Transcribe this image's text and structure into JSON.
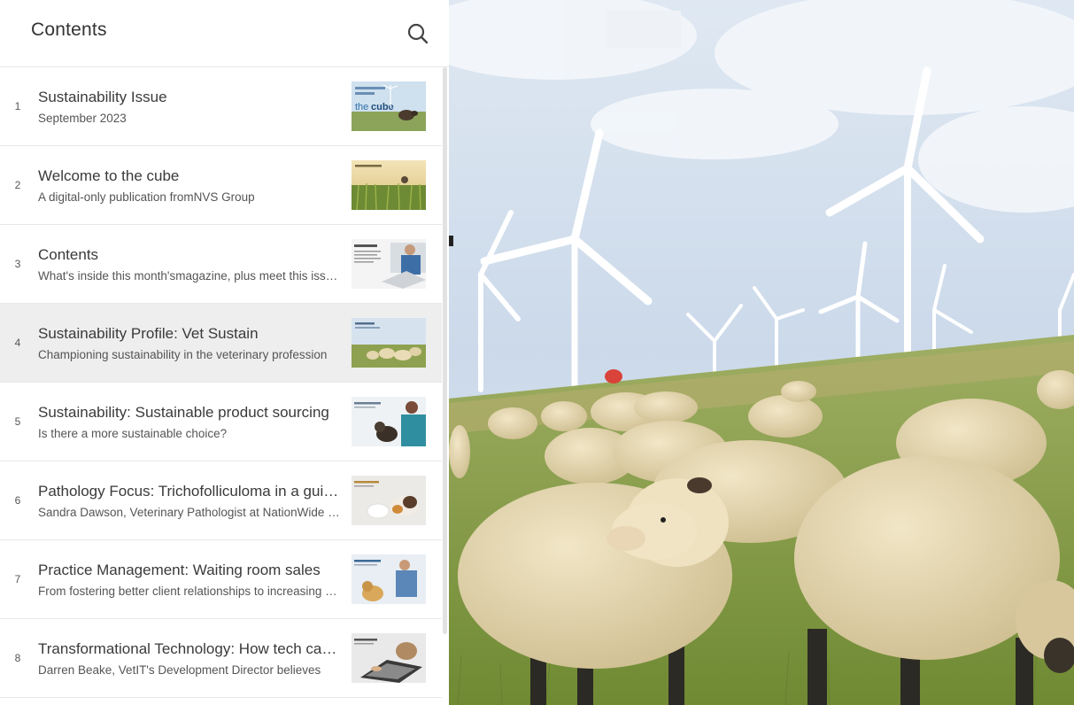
{
  "sidebar": {
    "title": "Contents",
    "search_icon": "search-icon",
    "items": [
      {
        "num": "1",
        "title": "Sustainability Issue",
        "subtitle": "September 2023",
        "thumb": "cube-cover"
      },
      {
        "num": "2",
        "title": "Welcome to the cube",
        "subtitle": "A digital-only publication fromNVS Group",
        "thumb": "field"
      },
      {
        "num": "3",
        "title": "Contents",
        "subtitle": "What's inside this month'smagazine, plus meet this issue's contributors",
        "thumb": "laptop"
      },
      {
        "num": "4",
        "title": "Sustainability Profile: Vet Sustain",
        "subtitle": "Championing sustainability in the veterinary profession",
        "thumb": "sheep"
      },
      {
        "num": "5",
        "title": "Sustainability: Sustainable product sourcing",
        "subtitle": "Is there a more sustainable choice?",
        "thumb": "vet-cat"
      },
      {
        "num": "6",
        "title": "Pathology Focus: Trichofolliculoma in a guinea pig",
        "subtitle": "Sandra Dawson, Veterinary Pathologist at NationWide Laboratories",
        "thumb": "guinea-pig"
      },
      {
        "num": "7",
        "title": "Practice Management: Waiting room sales",
        "subtitle": "From fostering better client relationships to increasing revenue",
        "thumb": "vet-dog"
      },
      {
        "num": "8",
        "title": "Transformational Technology: How tech can help",
        "subtitle": "Darren Beake, VetIT's Development Director believes",
        "thumb": "typing-cat"
      }
    ],
    "active_index": 4
  },
  "hero": {
    "image": "sheep-wind-turbines"
  },
  "colors": {
    "active_row": "#eeeeee",
    "text": "#3a3a3a",
    "sky": "#c9d9ec",
    "grass": "#8ea155",
    "wool": "#e6d8b0"
  }
}
